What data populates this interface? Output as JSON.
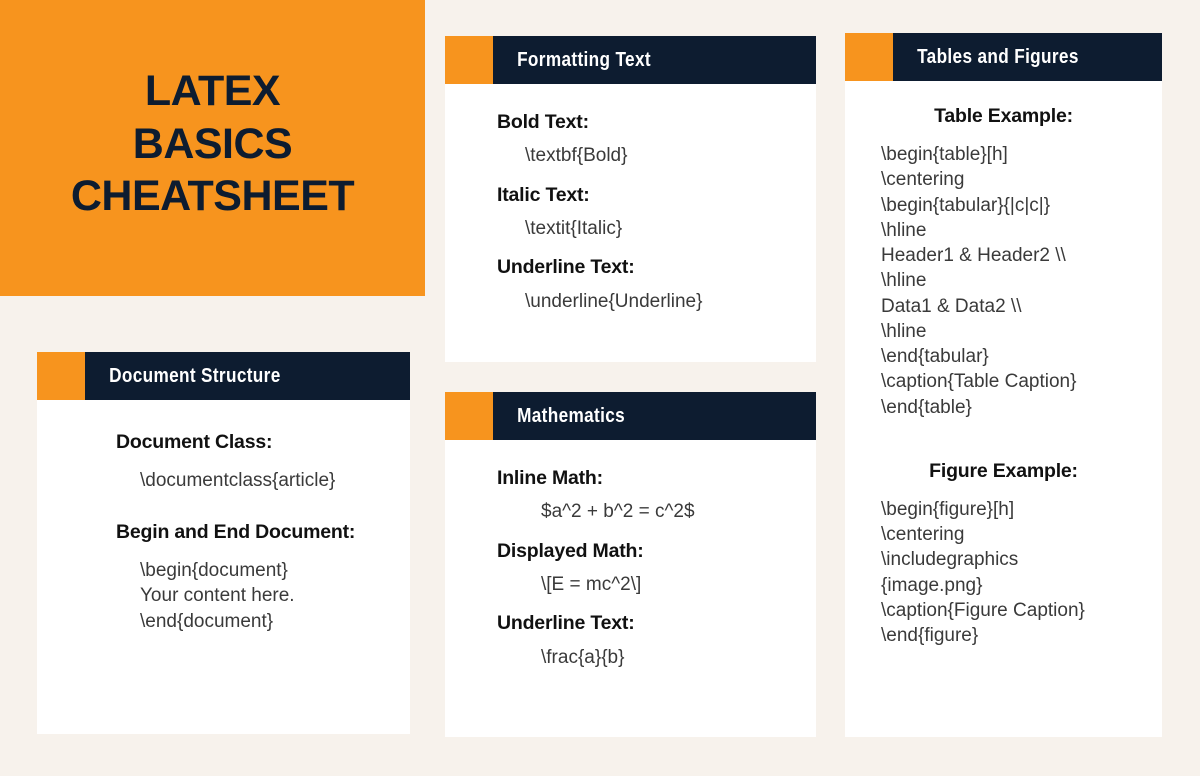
{
  "theme": {
    "background": "#f7f2ec",
    "accent_orange": "#f7941e",
    "header_navy": "#0d1c30",
    "card_background": "#ffffff",
    "label_text": "#111111",
    "code_text": "#3a3a3a"
  },
  "title": {
    "line1": "LATEX",
    "line2": "BASICS",
    "line3": "CHEATSHEET"
  },
  "cards": {
    "document_structure": {
      "header": "Document Structure",
      "entries": [
        {
          "label": "Document Class:",
          "code": "\\documentclass{article}"
        },
        {
          "label": "Begin and End Document:",
          "code": "\\begin{document}\nYour content here.\n\\end{document}"
        }
      ]
    },
    "formatting_text": {
      "header": "Formatting Text",
      "entries": [
        {
          "label": "Bold Text:",
          "code": "\\textbf{Bold}"
        },
        {
          "label": "Italic Text:",
          "code": "\\textit{Italic}"
        },
        {
          "label": "Underline Text:",
          "code": "\\underline{Underline}"
        }
      ]
    },
    "mathematics": {
      "header": "Mathematics",
      "entries": [
        {
          "label": "Inline Math:",
          "code": "$a^2 + b^2 = c^2$"
        },
        {
          "label": "Displayed Math:",
          "code": "\\[E = mc^2\\]"
        },
        {
          "label": "Underline Text:",
          "code": "\\frac{a}{b}"
        }
      ]
    },
    "tables_and_figures": {
      "header": "Tables and Figures",
      "table_heading": "Table Example:",
      "table_code": "\\begin{table}[h]\n\\centering\n\\begin{tabular}{|c|c|}\n\\hline\nHeader1 & Header2 \\\\\n\\hline\nData1 & Data2 \\\\\n\\hline\n\\end{tabular}\n\\caption{Table Caption}\n\\end{table}",
      "figure_heading": "Figure Example:",
      "figure_code": "\\begin{figure}[h]\n\\centering\n\\includegraphics\n{image.png}\n\\caption{Figure Caption}\n\\end{figure}"
    }
  }
}
